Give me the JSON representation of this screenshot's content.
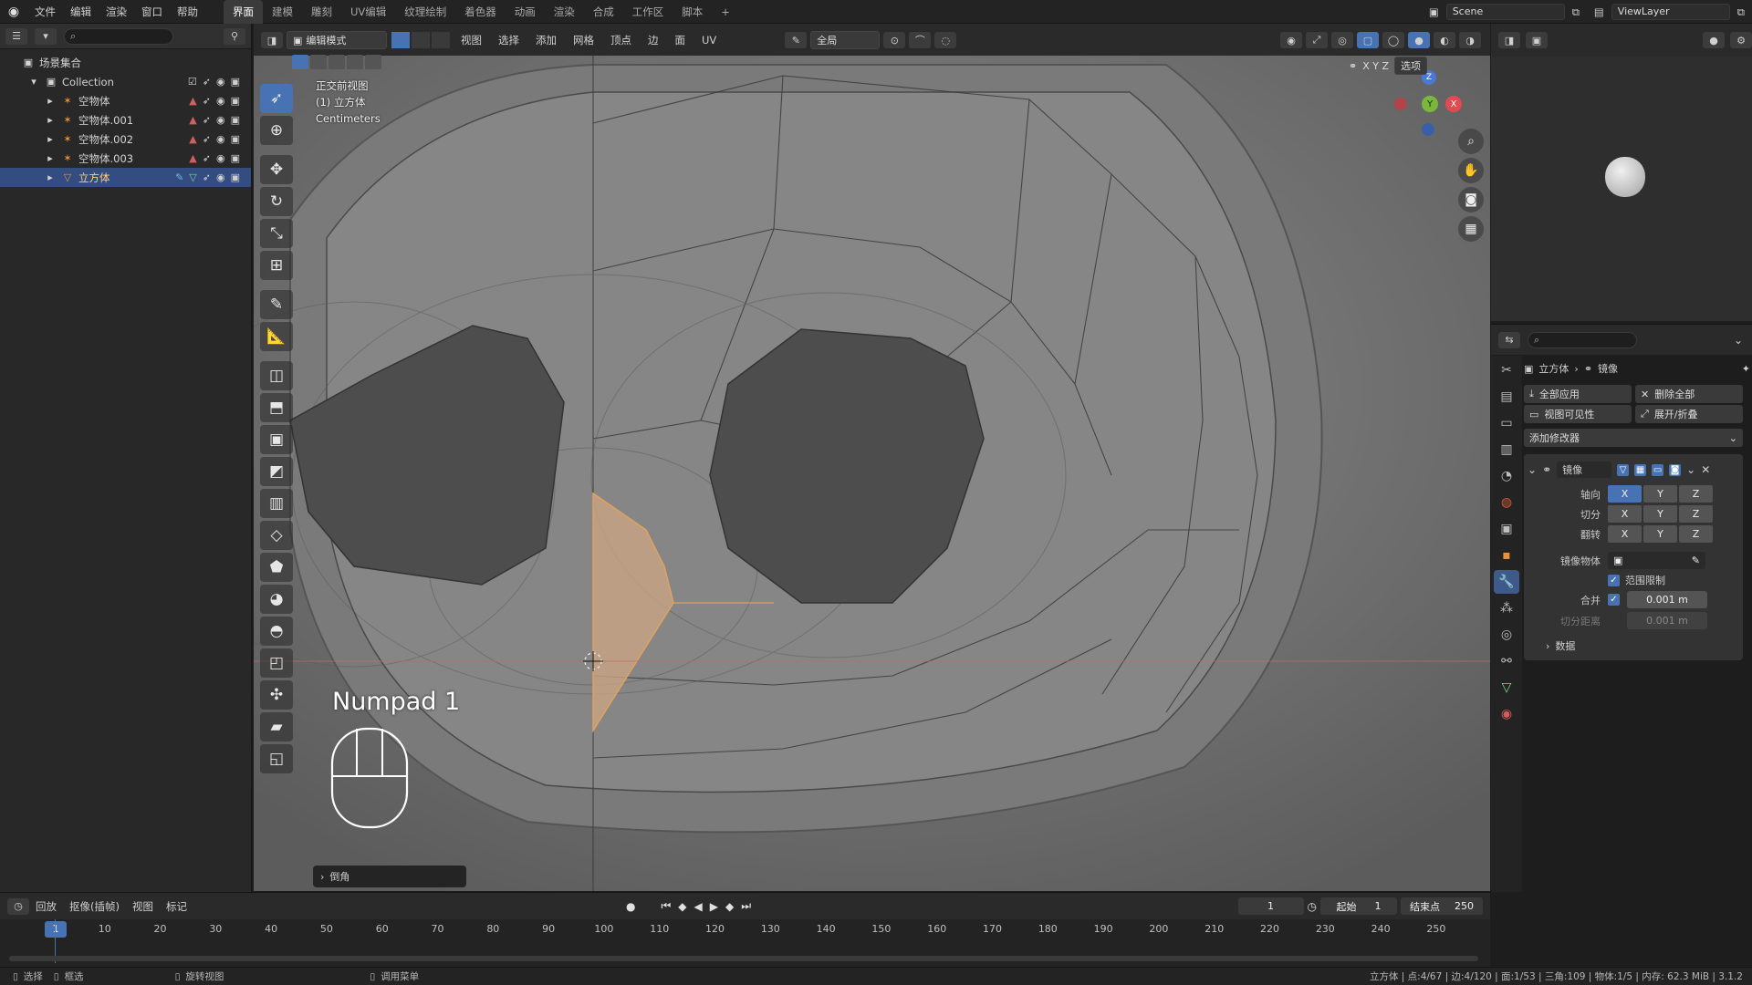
{
  "topbar": {
    "menus": [
      "文件",
      "编辑",
      "渲染",
      "窗口",
      "帮助"
    ],
    "workspaces": [
      "界面",
      "建模",
      "雕刻",
      "UV编辑",
      "纹理绘制",
      "着色器",
      "动画",
      "渲染",
      "合成",
      "工作区",
      "脚本"
    ],
    "active_workspace": "界面",
    "add_tab": "+",
    "scene_label": "Scene",
    "viewlayer_label": "ViewLayer"
  },
  "outliner": {
    "search_placeholder": "",
    "root": "场景集合",
    "collection": "Collection",
    "items": [
      {
        "name": "空物体",
        "selected": false
      },
      {
        "name": "空物体.001",
        "selected": false
      },
      {
        "name": "空物体.002",
        "selected": false
      },
      {
        "name": "空物体.003",
        "selected": false
      },
      {
        "name": "立方体",
        "selected": true
      }
    ]
  },
  "viewport_header": {
    "mode": "编辑模式",
    "menus": [
      "视图",
      "选择",
      "添加",
      "网格",
      "顶点",
      "边",
      "面",
      "UV"
    ],
    "transform": "全局",
    "options": "选项",
    "axis_xyz": "X Y Z"
  },
  "viewport": {
    "view_name": "正交前视图",
    "object_label": "(1) 立方体",
    "units": "Centimeters",
    "key_hint": "Numpad 1",
    "last_op": "倒角"
  },
  "gizmo": {
    "x": "X",
    "y": "Y",
    "z": "Z"
  },
  "properties": {
    "breadcrumb_object": "立方体",
    "breadcrumb_modifier": "镜像",
    "apply_all": "全部应用",
    "delete_all": "删除全部",
    "viewport_visibility": "视图可见性",
    "expand_collapse": "展开/折叠",
    "add_modifier": "添加修改器",
    "modifier_name": "镜像",
    "axis_label": "轴向",
    "bisect_label": "切分",
    "flip_label": "翻转",
    "mirror_object_label": "镜像物体",
    "clipping_label": "范围限制",
    "merge_label": "合并",
    "merge_value": "0.001 m",
    "bisect_distance_label": "切分距离",
    "bisect_distance_value": "0.001 m",
    "data_label": "数据",
    "axis": [
      "X",
      "Y",
      "Z"
    ]
  },
  "timeline": {
    "playback": "回放",
    "keying": "抠像(插帧)",
    "view": "视图",
    "marker": "标记",
    "current_frame": "1",
    "start_label": "起始",
    "start_value": "1",
    "end_label": "结束点",
    "end_value": "250",
    "ticks": [
      "10",
      "20",
      "30",
      "40",
      "50",
      "60",
      "70",
      "80",
      "90",
      "100",
      "110",
      "120",
      "130",
      "140",
      "150",
      "160",
      "170",
      "180",
      "190",
      "200",
      "210",
      "220",
      "230",
      "240",
      "250"
    ],
    "frame_marker": "1"
  },
  "statusbar": {
    "select": "选择",
    "box_select": "框选",
    "rotate_view": "旋转视图",
    "call_menu": "调用菜单",
    "stats": "立方体 | 点:4/67 | 边:4/120 | 面:1/53 | 三角:109 | 物体:1/5 | 内存: 62.3 MiB | 3.1.2"
  }
}
